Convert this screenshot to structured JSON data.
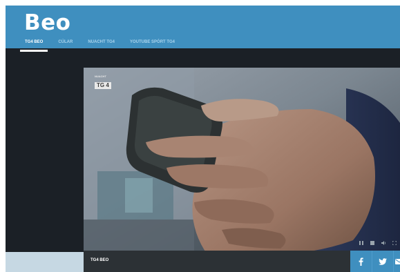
{
  "header": {
    "logo": "Beo",
    "nav": [
      {
        "label": "TG4 BEO",
        "active": true
      },
      {
        "label": "CÚLAR",
        "active": false
      },
      {
        "label": "NUACHT TG4",
        "active": false
      },
      {
        "label": "YOUTUBE SPÓRT TG4",
        "active": false
      }
    ]
  },
  "player": {
    "bug_top": "NUACHT",
    "bug_logo": "TG 4",
    "controls": [
      "pause-icon",
      "stop-icon",
      "volume-icon",
      "fullscreen-icon"
    ],
    "caption": "TG4 BEO"
  },
  "share": {
    "facebook": "f",
    "icons": [
      "facebook-icon",
      "twitter-icon",
      "email-icon"
    ]
  },
  "colors": {
    "brand_blue": "#3f8fbf",
    "nav_inactive": "#a9d3ec",
    "page_dark": "#1b2026",
    "caption_bar": "#2c3135"
  }
}
